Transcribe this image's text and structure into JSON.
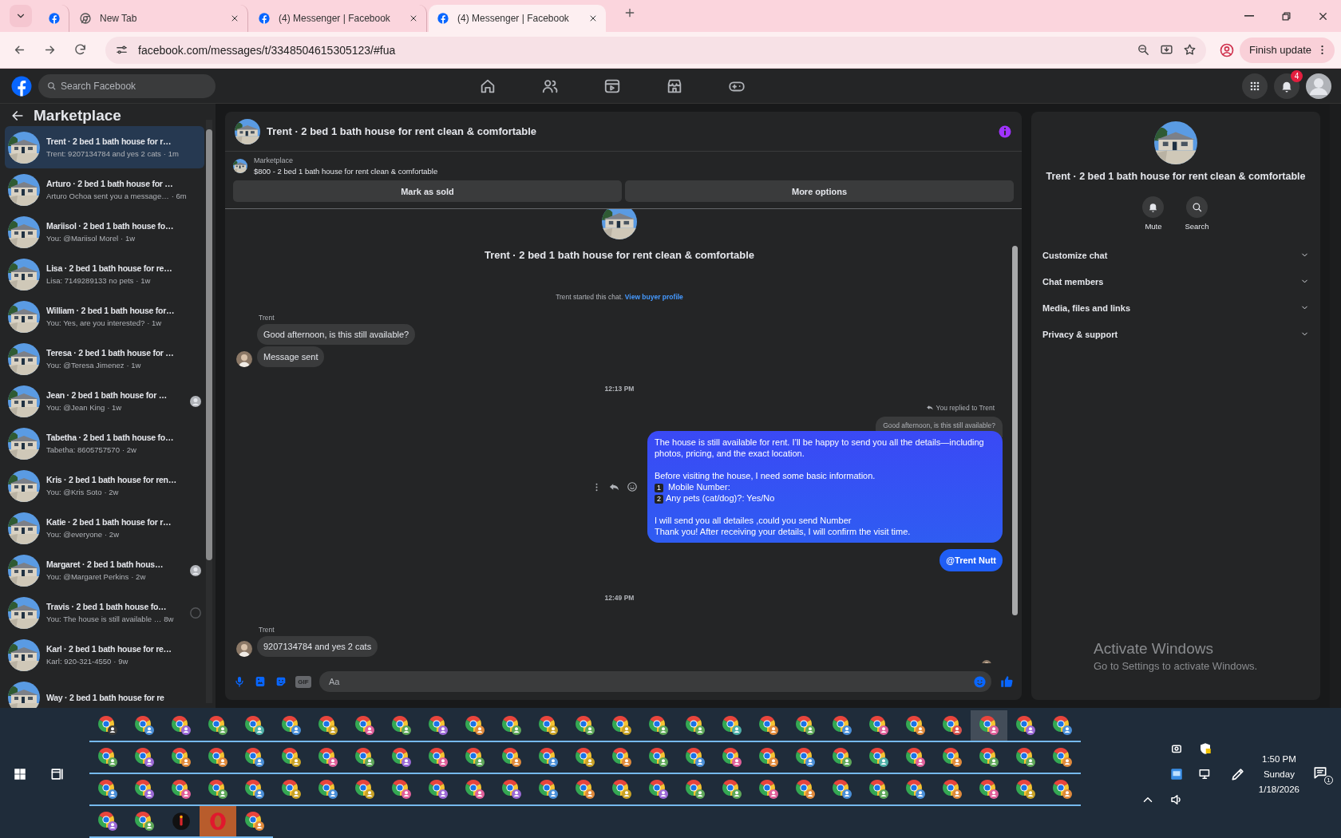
{
  "browser": {
    "tabs": [
      {
        "kind": "facebook",
        "selected": false
      },
      {
        "kind": "chrome",
        "title": "New Tab",
        "selected": false
      },
      {
        "kind": "facebook",
        "title": "(4) Messenger | Facebook",
        "selected": false
      },
      {
        "kind": "facebook",
        "title": "(4) Messenger | Facebook",
        "selected": true
      }
    ],
    "url": "facebook.com/messages/t/3348504615305123/#fua",
    "update_button": "Finish update"
  },
  "facebook_bar": {
    "search_placeholder": "Search Facebook",
    "notification_count": "4"
  },
  "sidebar": {
    "title": "Marketplace",
    "threads": [
      {
        "title": "Trent · 2 bed 1 bath house for r…",
        "preview": "Trent: 9207134784 and yes 2 cats",
        "time": "· 1m",
        "selected": true,
        "seen": false,
        "sent": false
      },
      {
        "title": "Arturo · 2 bed 1 bath house for …",
        "preview": "Arturo Ochoa sent you a message…",
        "time": "· 6m",
        "selected": false,
        "seen": false,
        "sent": false
      },
      {
        "title": "Mariisol · 2 bed 1 bath house fo…",
        "preview": "You: @Mariisol Morel",
        "time": "· 1w",
        "selected": false,
        "seen": false,
        "sent": false
      },
      {
        "title": "Lisa · 2 bed 1 bath house for re…",
        "preview": "Lisa: 7149289133 no pets",
        "time": "· 1w",
        "selected": false,
        "seen": false,
        "sent": false
      },
      {
        "title": "William · 2 bed 1 bath house for…",
        "preview": "You: Yes, are you interested?",
        "time": "· 1w",
        "selected": false,
        "seen": false,
        "sent": false
      },
      {
        "title": "Teresa · 2 bed 1 bath house for …",
        "preview": "You: @Teresa Jimenez",
        "time": "· 1w",
        "selected": false,
        "seen": false,
        "sent": false
      },
      {
        "title": "Jean · 2 bed 1 bath house for …",
        "preview": "You: @Jean King",
        "time": "· 1w",
        "selected": false,
        "seen": true,
        "sent": false
      },
      {
        "title": "Tabetha · 2 bed 1 bath house fo…",
        "preview": "Tabetha: 8605757570",
        "time": "· 2w",
        "selected": false,
        "seen": false,
        "sent": false
      },
      {
        "title": "Kris · 2 bed 1 bath house for ren…",
        "preview": "You: @Kris Soto",
        "time": "· 2w",
        "selected": false,
        "seen": false,
        "sent": false
      },
      {
        "title": "Katie · 2 bed 1 bath house for r…",
        "preview": "You: @everyone",
        "time": "· 2w",
        "selected": false,
        "seen": false,
        "sent": false
      },
      {
        "title": "Margaret · 2 bed 1 bath hous…",
        "preview": "You: @Margaret Perkins",
        "time": "· 2w",
        "selected": false,
        "seen": true,
        "sent": false
      },
      {
        "title": "Travis · 2 bed 1 bath house fo…",
        "preview": "You: The house is still available …",
        "time": "8w",
        "selected": false,
        "seen": false,
        "sent": true
      },
      {
        "title": "Karl · 2 bed 1 bath house for re…",
        "preview": "Karl: 920-321-4550",
        "time": "· 9w",
        "selected": false,
        "seen": false,
        "sent": false
      },
      {
        "title": "Way · 2 bed 1 bath house for re",
        "selected": false,
        "seen": false,
        "sent": false
      }
    ]
  },
  "chat": {
    "title": "Trent · 2 bed 1 bath house for rent clean & comfortable",
    "listing_label": "Marketplace",
    "listing": "$800 - 2 bed 1 bath house for rent clean & comfortable",
    "buttons": [
      "Mark as sold",
      "More options"
    ],
    "intro_title": "Trent · 2 bed 1 bath house for rent clean & comfortable",
    "intro_text": "Trent started this chat.",
    "intro_link": "View buyer profile",
    "messages": [
      {
        "kind": "sender",
        "text": "Trent"
      },
      {
        "kind": "incoming",
        "text": "Good afternoon, is this still available?",
        "avatar": false
      },
      {
        "kind": "incoming",
        "text": "Message sent",
        "avatar": true
      },
      {
        "kind": "time",
        "text": "12:13 PM"
      },
      {
        "kind": "reply_note",
        "text": "You replied to Trent"
      },
      {
        "kind": "quote",
        "text": "Good afternoon, is this still available?"
      },
      {
        "kind": "outgoing",
        "actions": true,
        "blocks": [
          [
            "The house is still available for rent. I’ll be happy to send you all the details—including photos, pricing, and the exact location."
          ],
          [
            "Before visiting the house, I need some basic information.",
            {
              "key": "1",
              "text": " Mobile Number:"
            },
            {
              "key": "2",
              "text": "Any pets (cat/dog)?: Yes/No"
            }
          ],
          [
            "I will send you all detailes ,could you send Number",
            "Thank you! After receiving your details, I will confirm the visit time."
          ]
        ]
      },
      {
        "kind": "outgoing",
        "bold": true,
        "blocks": [
          [
            "@Trent Nutt"
          ]
        ]
      },
      {
        "kind": "time",
        "text": "12:49 PM"
      },
      {
        "kind": "sender",
        "text": "Trent"
      },
      {
        "kind": "incoming",
        "text": "9207134784 and yes 2 cats",
        "avatar": true
      },
      {
        "kind": "seen_avatar"
      }
    ],
    "composer": {
      "placeholder": "Aa",
      "gif_label": "GIF"
    }
  },
  "details": {
    "title": "Trent · 2 bed 1 bath house for rent clean & comfortable",
    "actions": [
      {
        "kind": "bell",
        "label": "Mute"
      },
      {
        "kind": "search",
        "label": "Search"
      }
    ],
    "sections": [
      {
        "label": "Customize chat",
        "expanded": false
      },
      {
        "label": "Chat members",
        "expanded": false
      },
      {
        "label": "Media, files and links",
        "expanded": false
      },
      {
        "label": "Privacy & support",
        "expanded": false
      }
    ]
  },
  "activation_notice": {
    "title": "Activate Windows",
    "text": "Go to Settings to activate Windows."
  },
  "taskbar": {
    "apps": [
      {
        "kind": "chrome",
        "color": "#3a3a3a",
        "selected": false
      },
      {
        "kind": "chrome",
        "color": "#4a8fd8",
        "selected": false
      },
      {
        "kind": "chrome",
        "color": "#9c6ad6",
        "selected": false
      },
      {
        "kind": "chrome",
        "color": "#5fa85a",
        "selected": false
      },
      {
        "kind": "chrome",
        "color": "#4fb0a8",
        "selected": false
      },
      {
        "kind": "chrome",
        "color": "#4a8fd8",
        "selected": false
      },
      {
        "kind": "chrome",
        "color": "#c9a227",
        "selected": false
      },
      {
        "kind": "chrome",
        "color": "#e0609a",
        "selected": false
      },
      {
        "kind": "chrome",
        "color": "#5fa85a",
        "selected": false
      },
      {
        "kind": "chrome",
        "color": "#9c6ad6",
        "selected": false
      },
      {
        "kind": "chrome",
        "color": "#e08a3c",
        "selected": false
      },
      {
        "kind": "chrome",
        "color": "#5fa85a",
        "selected": false
      },
      {
        "kind": "chrome",
        "color": "#c9a227",
        "selected": false
      },
      {
        "kind": "chrome",
        "color": "#5fa85a",
        "selected": false
      },
      {
        "kind": "chrome",
        "color": "#c9a227",
        "selected": false
      },
      {
        "kind": "chrome",
        "color": "#5fa85a",
        "selected": false
      },
      {
        "kind": "chrome",
        "color": "#5fa85a",
        "selected": false
      },
      {
        "kind": "chrome",
        "color": "#4fb0a8",
        "selected": false
      },
      {
        "kind": "chrome",
        "color": "#e08a3c",
        "selected": false
      },
      {
        "kind": "chrome",
        "color": "#5fa85a",
        "selected": false
      },
      {
        "kind": "chrome",
        "color": "#4a8fd8",
        "selected": false
      },
      {
        "kind": "chrome",
        "color": "#e0609a",
        "selected": false
      },
      {
        "kind": "chrome",
        "color": "#e08a3c",
        "selected": false
      },
      {
        "kind": "chrome",
        "color": "#d9534f",
        "selected": false
      },
      {
        "kind": "chrome",
        "color": "#e0609a",
        "selected": true
      },
      {
        "kind": "chrome",
        "color": "#9c6ad6",
        "selected": false
      },
      {
        "kind": "chrome",
        "color": "#4a8fd8",
        "selected": false
      },
      {
        "kind": "chrome",
        "color": "#5fa85a",
        "selected": false
      },
      {
        "kind": "chrome",
        "color": "#9c6ad6",
        "selected": false
      },
      {
        "kind": "chrome",
        "color": "#e08a3c",
        "selected": false
      },
      {
        "kind": "chrome",
        "color": "#e08a3c",
        "selected": false
      },
      {
        "kind": "chrome",
        "color": "#4a8fd8",
        "selected": false
      },
      {
        "kind": "chrome",
        "color": "#c9a227",
        "selected": false
      },
      {
        "kind": "chrome",
        "color": "#e0609a",
        "selected": false
      },
      {
        "kind": "chrome",
        "color": "#5fa85a",
        "selected": false
      },
      {
        "kind": "chrome",
        "color": "#9c6ad6",
        "selected": false
      },
      {
        "kind": "chrome",
        "color": "#e0609a",
        "selected": false
      },
      {
        "kind": "chrome",
        "color": "#5fa85a",
        "selected": false
      },
      {
        "kind": "chrome",
        "color": "#e08a3c",
        "selected": false
      },
      {
        "kind": "chrome",
        "color": "#4a8fd8",
        "selected": false
      },
      {
        "kind": "chrome",
        "color": "#c9a227",
        "selected": false
      },
      {
        "kind": "chrome",
        "color": "#e08a3c",
        "selected": false
      },
      {
        "kind": "chrome",
        "color": "#5fa85a",
        "selected": false
      },
      {
        "kind": "chrome",
        "color": "#4a8fd8",
        "selected": false
      },
      {
        "kind": "chrome",
        "color": "#e0609a",
        "selected": false
      },
      {
        "kind": "chrome",
        "color": "#e08a3c",
        "selected": false
      },
      {
        "kind": "chrome",
        "color": "#4a8fd8",
        "selected": false
      },
      {
        "kind": "chrome",
        "color": "#5fa85a",
        "selected": false
      },
      {
        "kind": "chrome",
        "color": "#4fb0a8",
        "selected": false
      },
      {
        "kind": "chrome",
        "color": "#e0609a",
        "selected": false
      },
      {
        "kind": "chrome",
        "color": "#e08a3c",
        "selected": false
      },
      {
        "kind": "chrome",
        "color": "#5fa85a",
        "selected": false
      },
      {
        "kind": "chrome",
        "color": "#5fa85a",
        "selected": false
      },
      {
        "kind": "chrome",
        "color": "#e08a3c",
        "selected": false
      },
      {
        "kind": "chrome",
        "color": "#4a8fd8",
        "selected": false
      },
      {
        "kind": "chrome",
        "color": "#9c6ad6",
        "selected": false
      },
      {
        "kind": "chrome",
        "color": "#e0609a",
        "selected": false
      },
      {
        "kind": "chrome",
        "color": "#5fa85a",
        "selected": false
      },
      {
        "kind": "chrome",
        "color": "#4a8fd8",
        "selected": false
      },
      {
        "kind": "chrome",
        "color": "#c9a227",
        "selected": false
      },
      {
        "kind": "chrome",
        "color": "#4a8fd8",
        "selected": false
      },
      {
        "kind": "chrome",
        "color": "#c9a227",
        "selected": false
      },
      {
        "kind": "chrome",
        "color": "#e0609a",
        "selected": false
      },
      {
        "kind": "chrome",
        "color": "#9c6ad6",
        "selected": false
      },
      {
        "kind": "chrome",
        "color": "#e0609a",
        "selected": false
      },
      {
        "kind": "chrome",
        "color": "#9c6ad6",
        "selected": false
      },
      {
        "kind": "chrome",
        "color": "#4a8fd8",
        "selected": false
      },
      {
        "kind": "chrome",
        "color": "#e08a3c",
        "selected": false
      },
      {
        "kind": "chrome",
        "color": "#c9a227",
        "selected": false
      },
      {
        "kind": "chrome",
        "color": "#9c6ad6",
        "selected": false
      },
      {
        "kind": "chrome",
        "color": "#5fa85a",
        "selected": false
      },
      {
        "kind": "chrome",
        "color": "#5fa85a",
        "selected": false
      },
      {
        "kind": "chrome",
        "color": "#e0609a",
        "selected": false
      },
      {
        "kind": "chrome",
        "color": "#e08a3c",
        "selected": false
      },
      {
        "kind": "chrome",
        "color": "#4a8fd8",
        "selected": false
      },
      {
        "kind": "chrome",
        "color": "#5fa85a",
        "selected": false
      },
      {
        "kind": "chrome",
        "color": "#4a8fd8",
        "selected": false
      },
      {
        "kind": "chrome",
        "color": "#e08a3c",
        "selected": false
      },
      {
        "kind": "chrome",
        "color": "#e0609a",
        "selected": false
      },
      {
        "kind": "chrome",
        "color": "#c9a227",
        "selected": false
      },
      {
        "kind": "chrome",
        "color": "#e08a3c",
        "selected": false
      },
      {
        "kind": "chrome",
        "color": "#9c6ad6",
        "selected": false
      },
      {
        "kind": "chrome",
        "color": "#5fa85a",
        "selected": false
      },
      {
        "kind": "app",
        "selected": false
      },
      {
        "kind": "opera",
        "selected": false
      },
      {
        "kind": "chrome",
        "color": "#e08a3c",
        "selected": false
      }
    ],
    "clock": {
      "time": "1:50 PM",
      "day": "Sunday",
      "date": "1/18/2026"
    },
    "notification_count": "1"
  }
}
